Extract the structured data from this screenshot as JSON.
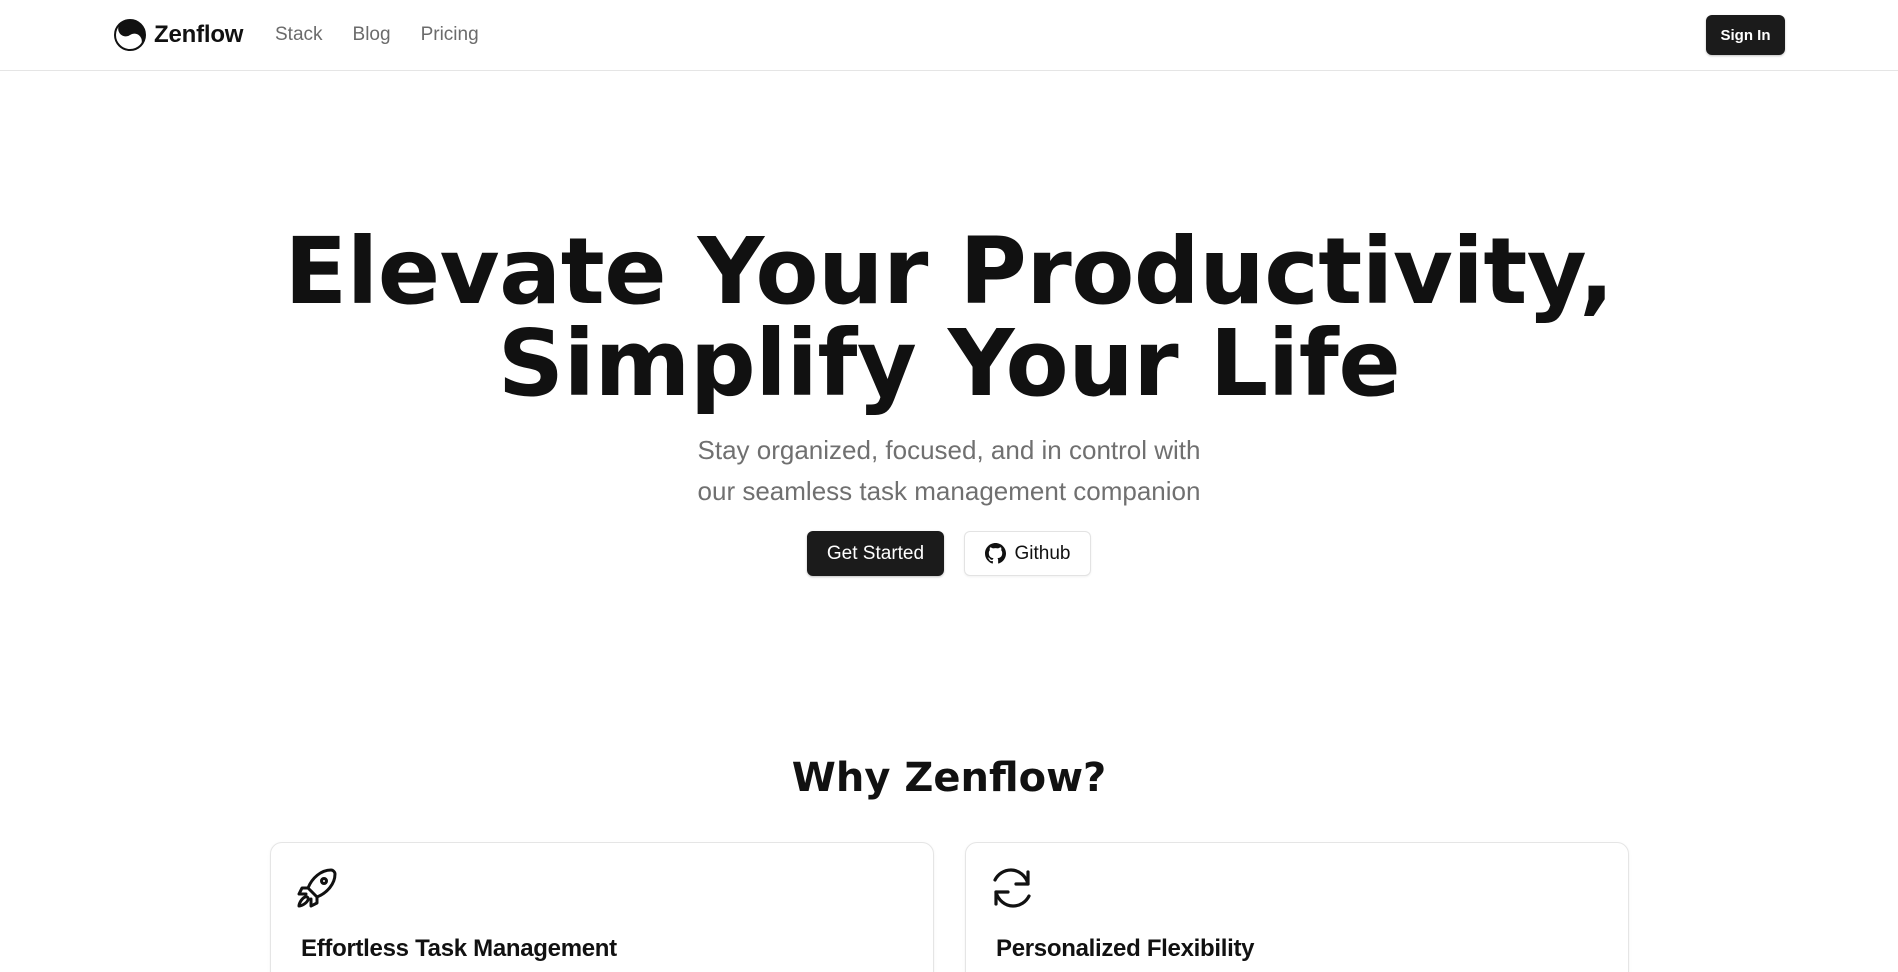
{
  "header": {
    "brand_name": "Zenflow",
    "logo_icon": "yin-yang-icon",
    "nav": [
      "Stack",
      "Blog",
      "Pricing"
    ],
    "sign_in_label": "Sign In"
  },
  "hero": {
    "title_line1": "Elevate Your Productivity,",
    "title_line2": "Simplify Your Life",
    "subtitle_line1": "Stay organized, focused, and in control with",
    "subtitle_line2": "our seamless task management companion",
    "primary_cta": "Get Started",
    "secondary_cta": "Github",
    "secondary_icon": "github-icon"
  },
  "why": {
    "title": "Why Zenflow?",
    "cards": [
      {
        "icon": "rocket-icon",
        "title": "Effortless Task Management"
      },
      {
        "icon": "refresh-icon",
        "title": "Personalized Flexibility"
      }
    ]
  },
  "colors": {
    "text": "#111111",
    "muted": "#707070",
    "button_dark": "#1b1b1b",
    "border": "#e5e5e5"
  }
}
